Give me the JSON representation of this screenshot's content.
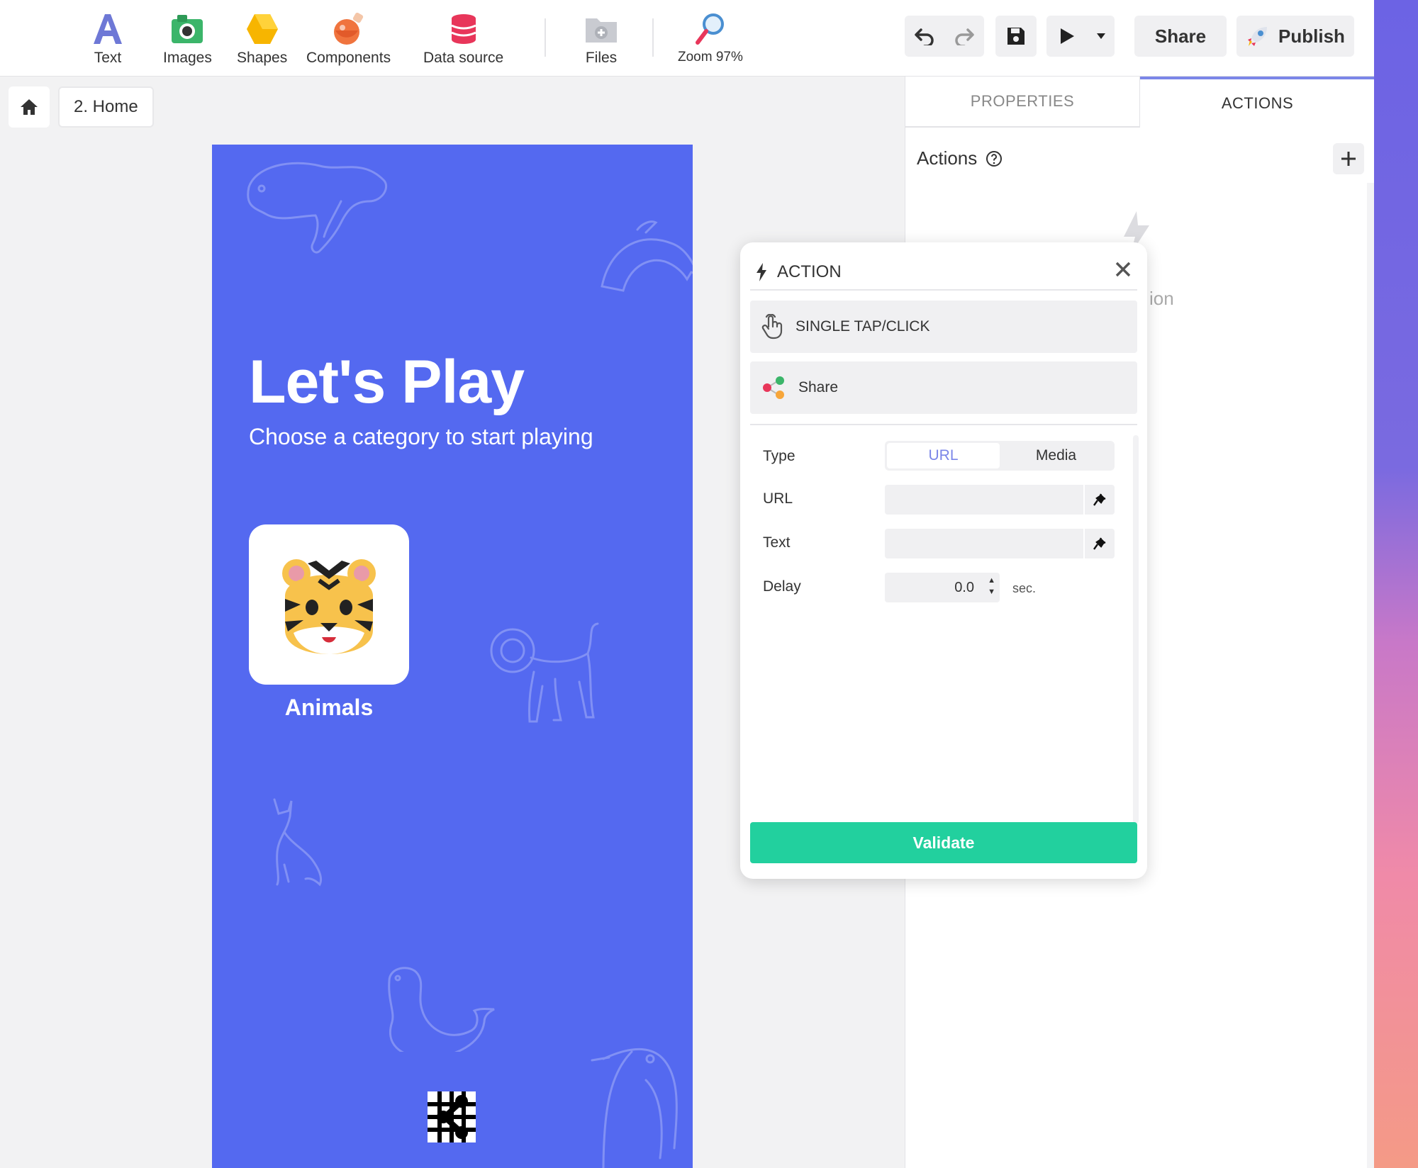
{
  "toolbar": {
    "tools": {
      "text": "Text",
      "images": "Images",
      "shapes": "Shapes",
      "components": "Components",
      "data_source": "Data source",
      "files": "Files",
      "zoom": "Zoom 97%"
    },
    "share_label": "Share",
    "publish_label": "Publish"
  },
  "breadcrumb": {
    "page": "2. Home"
  },
  "app": {
    "title": "Let's Play",
    "subtitle": "Choose a category to start playing",
    "category_label": "Animals",
    "colors": {
      "background": "#5469f0",
      "card": "#ffffff"
    }
  },
  "panel": {
    "tab_properties": "PROPERTIES",
    "tab_actions": "ACTIONS",
    "active_tab": "ACTIONS",
    "actions_title": "Actions",
    "ghost_text": "ion"
  },
  "popup": {
    "title": "ACTION",
    "trigger": "SINGLE TAP/CLICK",
    "action": "Share",
    "type_label": "Type",
    "type_options": [
      "URL",
      "Media"
    ],
    "type_selected": "URL",
    "url_label": "URL",
    "url_value": "",
    "text_label": "Text",
    "text_value": "",
    "delay_label": "Delay",
    "delay_value": "0.0",
    "delay_unit": "sec.",
    "validate_label": "Validate"
  },
  "colors": {
    "accent": "#7b86e8",
    "validate": "#22d09e",
    "canvas": "#5469f0"
  }
}
